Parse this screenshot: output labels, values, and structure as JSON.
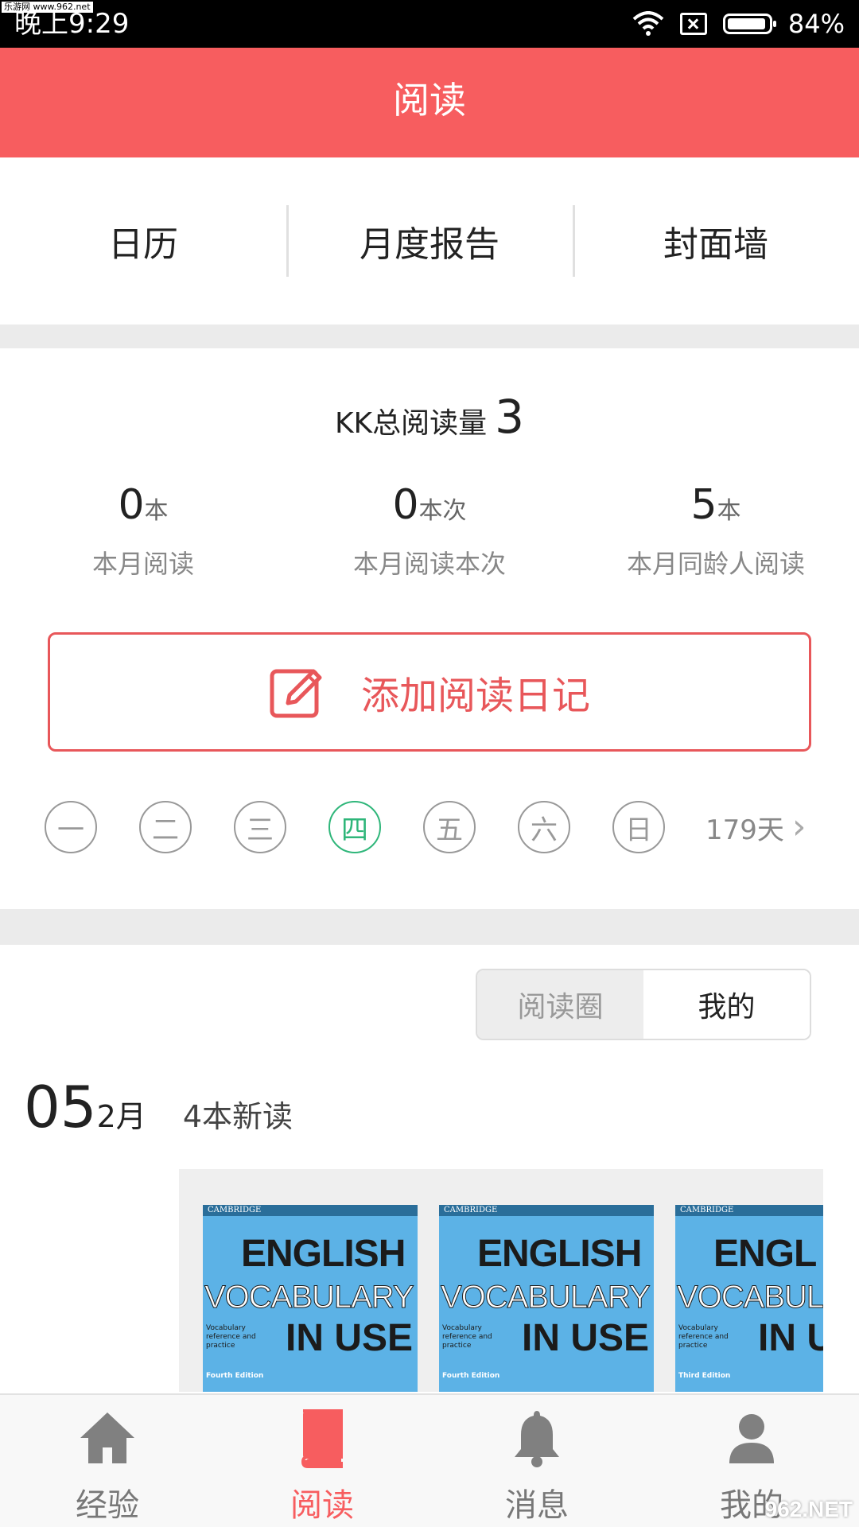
{
  "status_bar": {
    "watermark": "乐游网 www.962.net",
    "time": "晚上9:29",
    "battery": "84%",
    "icons": [
      "wifi-icon",
      "no-sim-icon",
      "battery-icon"
    ]
  },
  "header": {
    "title": "阅读"
  },
  "tabs": [
    {
      "label": "日历"
    },
    {
      "label": "月度报告"
    },
    {
      "label": "封面墙"
    }
  ],
  "summary": {
    "label": "KK总阅读量",
    "value": "3"
  },
  "stats": [
    {
      "num": "0",
      "unit": "本",
      "label": "本月阅读"
    },
    {
      "num": "0",
      "unit": "本次",
      "label": "本月阅读本次"
    },
    {
      "num": "5",
      "unit": "本",
      "label": "本月同龄人阅读"
    }
  ],
  "add_button": {
    "label": "添加阅读日记",
    "icon": "edit-icon"
  },
  "week": {
    "days": [
      "一",
      "二",
      "三",
      "四",
      "五",
      "六",
      "日"
    ],
    "active_index": 3,
    "streak": "179天"
  },
  "toggle": {
    "options": [
      "阅读圈",
      "我的"
    ],
    "selected": "我的"
  },
  "feed": {
    "day": "05",
    "month": "2月",
    "count": "4本新读"
  },
  "books": [
    {
      "publisher": "CAMBRIDGE",
      "line1": "ENGLISH",
      "line2": "VOCABULARY",
      "line3": "IN USE",
      "sub": "Vocabulary reference and practice",
      "edition": "Fourth Edition"
    },
    {
      "publisher": "CAMBRIDGE",
      "line1": "ENGLISH",
      "line2": "VOCABULARY",
      "line3": "IN USE",
      "sub": "Vocabulary reference and practice",
      "edition": "Fourth Edition"
    },
    {
      "publisher": "CAMBRIDGE",
      "line1": "ENGL",
      "line2": "VOCABUL",
      "line3": "IN U",
      "sub": "Vocabulary reference and practice",
      "edition": "Third Edition"
    }
  ],
  "bottom_nav": [
    {
      "label": "经验",
      "icon": "home-icon"
    },
    {
      "label": "阅读",
      "icon": "book-icon",
      "active": true
    },
    {
      "label": "消息",
      "icon": "bell-icon"
    },
    {
      "label": "我的",
      "icon": "user-icon"
    }
  ],
  "colors": {
    "accent": "#f75d5f",
    "active_day": "#2fb67a",
    "book_cover": "#5cb2e6"
  },
  "site_watermark": "962.NET"
}
